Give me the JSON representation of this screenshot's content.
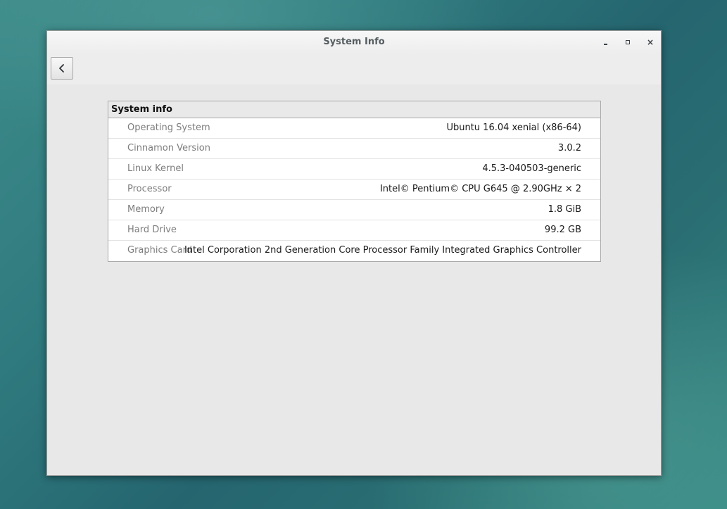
{
  "window": {
    "title": "System Info"
  },
  "titlebar_buttons": {
    "minimize_icon": "minimize-icon",
    "maximize_icon": "maximize-icon",
    "close_icon": "close-icon",
    "close_glyph": "×"
  },
  "toolbar": {
    "back_icon": "chevron-left-icon"
  },
  "system_info": {
    "header": "System info",
    "rows": [
      {
        "label": "Operating System",
        "value": "Ubuntu 16.04 xenial (x86-64)"
      },
      {
        "label": "Cinnamon Version",
        "value": "3.0.2"
      },
      {
        "label": "Linux Kernel",
        "value": "4.5.3-040503-generic"
      },
      {
        "label": "Processor",
        "value": "Intel© Pentium© CPU G645 @ 2.90GHz × 2"
      },
      {
        "label": "Memory",
        "value": "1.8 GiB"
      },
      {
        "label": "Hard Drive",
        "value": "99.2 GB"
      },
      {
        "label": "Graphics Card",
        "value": "Intel Corporation 2nd Generation Core Processor Family Integrated Graphics Controller"
      }
    ]
  }
}
